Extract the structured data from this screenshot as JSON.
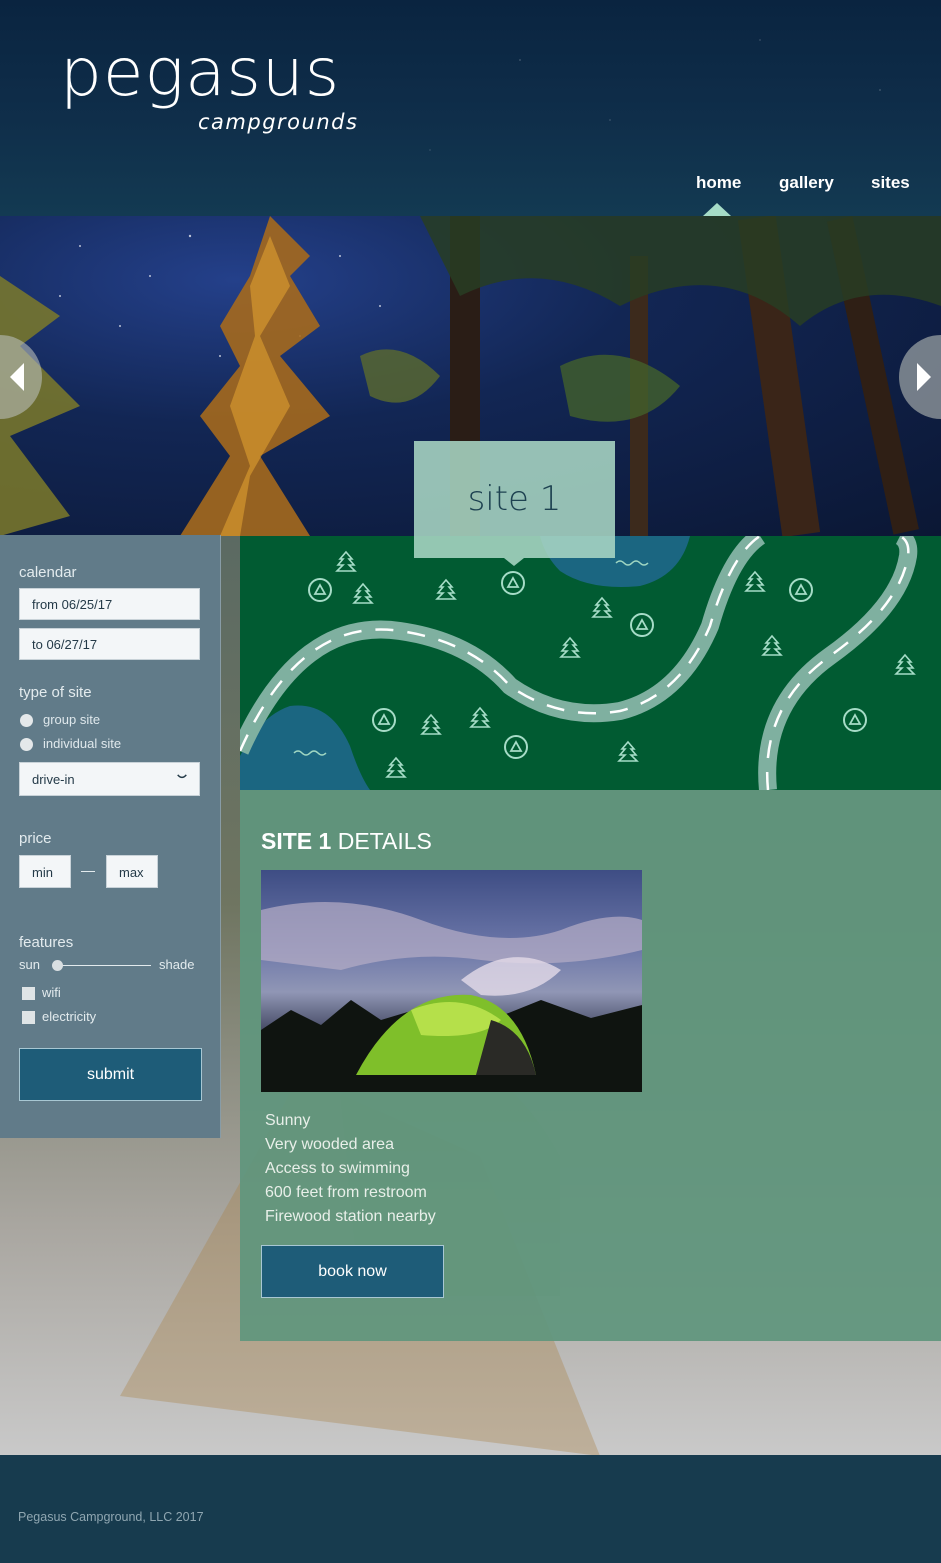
{
  "brand": {
    "name": "pegasus",
    "tagline": "campgrounds"
  },
  "nav": {
    "items": [
      "home",
      "gallery",
      "sites"
    ],
    "active": "home"
  },
  "hero": {
    "site_label": "site 1"
  },
  "search": {
    "calendar_label": "calendar",
    "from_value": "from 06/25/17",
    "to_value": "to 06/27/17",
    "type_label": "type of site",
    "type_options": [
      "group site",
      "individual site"
    ],
    "access_select": "drive-in",
    "price_label": "price",
    "price_min": "min",
    "price_max": "max",
    "features_label": "features",
    "sun_label": "sun",
    "shade_label": "shade",
    "sun_shade_level": 0,
    "feature_checks": [
      "wifi",
      "electricity"
    ],
    "submit_label": "submit"
  },
  "details": {
    "title_bold": "SITE 1",
    "title_rest": " DETAILS",
    "features": [
      "Sunny",
      "Very wooded area",
      "Access to swimming",
      "600 feet from restroom",
      "Firewood station nearby"
    ],
    "book_label": "book now"
  },
  "footer": {
    "text": "Pegasus Campground, LLC 2017"
  },
  "colors": {
    "map_green": "#015b32",
    "accent_mint": "#a6dcc7",
    "button_blue": "#1e5c78",
    "sidebar_slate": "#617b89",
    "footer_navy": "#173b4e"
  }
}
